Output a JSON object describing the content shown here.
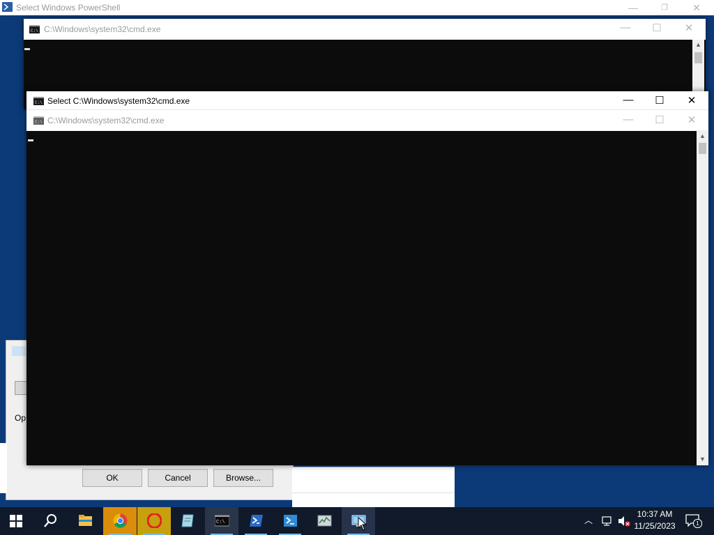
{
  "powershell": {
    "title": "Select Windows PowerShell"
  },
  "cmd_back": {
    "title": "C:\\Windows\\system32\\cmd.exe"
  },
  "cmd_front": {
    "title": "Select C:\\Windows\\system32\\cmd.exe",
    "inner_title": "C:\\Windows\\system32\\cmd.exe"
  },
  "window_controls": {
    "minimize": "—",
    "maximize": "☐",
    "close": "✕"
  },
  "dialog": {
    "label_fragment": "Op",
    "buttons": {
      "ok": "OK",
      "cancel": "Cancel",
      "browse": "Browse..."
    }
  },
  "taskbar": {
    "items": [
      {
        "icon": "windows-start-icon"
      },
      {
        "icon": "search-icon"
      },
      {
        "icon": "file-explorer-icon"
      },
      {
        "icon": "chrome-icon"
      },
      {
        "icon": "opera-icon"
      },
      {
        "icon": "notepad-icon"
      },
      {
        "icon": "cmd-icon"
      },
      {
        "icon": "powershell-icon"
      },
      {
        "icon": "powershell-ise-icon"
      },
      {
        "icon": "task-manager-icon"
      },
      {
        "icon": "remote-desktop-icon"
      }
    ],
    "clock": {
      "time": "10:37 AM",
      "date": "11/25/2023"
    },
    "notification_count": "1"
  },
  "colors": {
    "desktop": "#0c3a78",
    "console_bg": "#0c0c0c",
    "taskbar": "#101a2a",
    "accent": "#76b9ed"
  }
}
